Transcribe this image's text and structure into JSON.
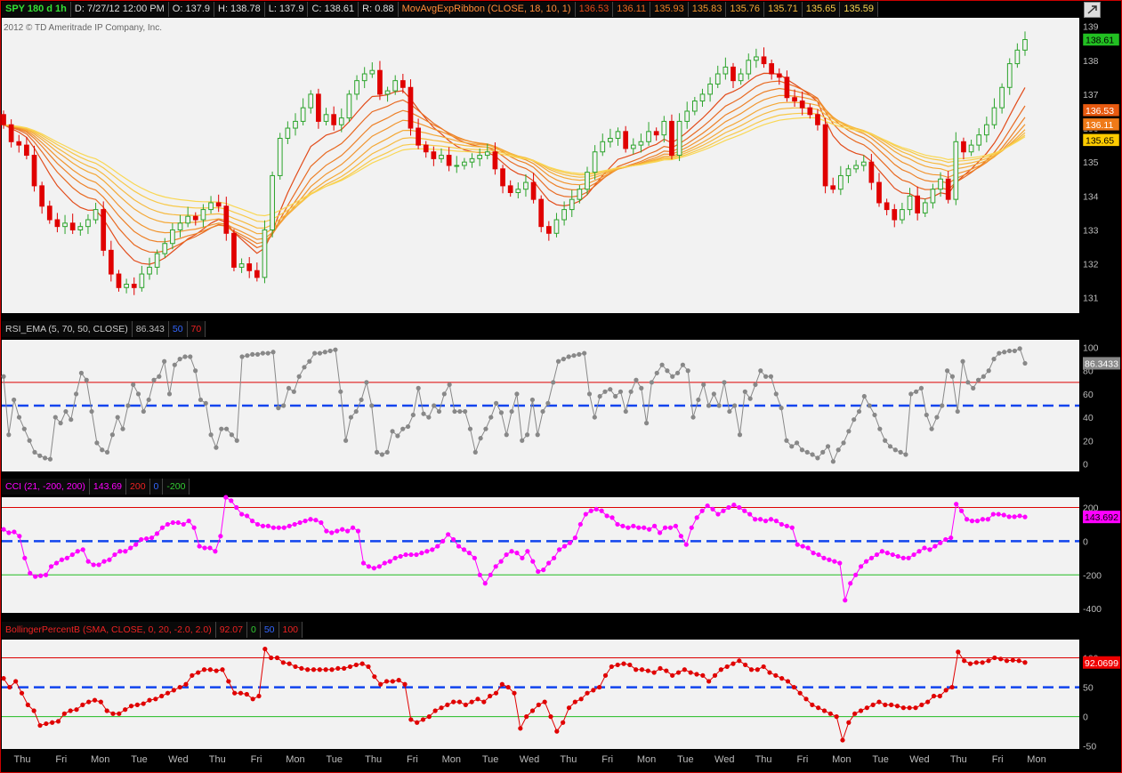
{
  "header": {
    "symbol": "SPY 180 d 1h",
    "date": "D: 7/27/12 12:00 PM",
    "open": "O: 137.9",
    "high": "H: 138.78",
    "low": "L: 137.9",
    "close": "C: 138.61",
    "range": "R: 0.88",
    "study": "MovAvgExpRibbon (CLOSE, 18, 10, 1)",
    "ribbon_values": [
      "136.53",
      "136.11",
      "135.93",
      "135.83",
      "135.76",
      "135.71",
      "135.65",
      "135.59"
    ],
    "copyright": "2012 © TD Ameritrade IP Company, Inc."
  },
  "colors": {
    "up": "#2ca42c",
    "down": "#e00000",
    "background": "#f2f2f2",
    "rsi_line": "#888888",
    "cci_line": "#ff00ff",
    "pctb_line": "#e00000",
    "ribbon": [
      "#e24b1a",
      "#e86a22",
      "#ed8128",
      "#f1952f",
      "#f4a836",
      "#f6b93e",
      "#f8c948",
      "#f9d754"
    ]
  },
  "price_tags": [
    {
      "value": 138.61,
      "text": "138.61",
      "bg": "#22c022",
      "fg": "#000"
    },
    {
      "value": 136.53,
      "text": "136.53",
      "bg": "#e85a10",
      "fg": "#fff"
    },
    {
      "value": 136.11,
      "text": "136.11",
      "bg": "#ef7a18",
      "fg": "#fff"
    },
    {
      "value": 135.65,
      "text": "135.65",
      "bg": "#ffcc00",
      "fg": "#000"
    }
  ],
  "rsi_panel": {
    "label": "RSI_EMA (5, 70, 50, CLOSE)",
    "value": "86.343",
    "mid": "50",
    "upper": "70",
    "tag": "86.3433",
    "ticks": [
      "100",
      "80",
      "60",
      "40",
      "20",
      "0"
    ]
  },
  "cci_panel": {
    "label": "CCI (21, -200, 200)",
    "value": "143.69",
    "upper": "200",
    "mid": "0",
    "lower": "-200",
    "tag": "143.692",
    "ticks": [
      "200",
      "0",
      "-200",
      "-400"
    ]
  },
  "pctb_panel": {
    "label": "BollingerPercentB (SMA, CLOSE, 0, 20, -2.0, 2.0)",
    "value": "92.07",
    "lower": "0",
    "mid": "50",
    "upper": "100",
    "tag": "92.0699",
    "ticks": [
      "100",
      "50",
      "0",
      "-50"
    ]
  },
  "x_axis": {
    "labels": [
      "Thu",
      "Fri",
      "Mon",
      "Tue",
      "Wed",
      "Thu",
      "Fri",
      "Mon",
      "Tue",
      "Thu",
      "Fri",
      "Mon",
      "Tue",
      "Wed",
      "Thu",
      "Fri",
      "Mon",
      "Tue",
      "Wed",
      "Thu",
      "Fri",
      "Mon",
      "Tue",
      "Wed",
      "Thu",
      "Fri",
      "Mon"
    ]
  },
  "chart_data": [
    {
      "type": "candlestick",
      "title": "SPY 180 d 1h",
      "ylim": [
        130.6,
        139.2
      ],
      "yticks": [
        131,
        132,
        133,
        134,
        135,
        136,
        137,
        138,
        139
      ],
      "close": [
        136.1,
        135.6,
        135.5,
        135.2,
        134.3,
        133.7,
        133.3,
        133.1,
        133.2,
        133.0,
        133.1,
        133.3,
        133.6,
        132.4,
        131.7,
        131.3,
        131.4,
        131.3,
        131.7,
        131.9,
        132.3,
        132.6,
        133.0,
        133.2,
        133.4,
        133.3,
        133.6,
        133.8,
        133.7,
        132.9,
        131.9,
        132.0,
        131.8,
        131.6,
        133.0,
        134.6,
        135.7,
        136.0,
        136.2,
        136.6,
        137.0,
        136.2,
        136.4,
        136.1,
        136.3,
        137.0,
        137.4,
        137.6,
        137.7,
        137.0,
        137.1,
        137.4,
        137.2,
        136.0,
        135.5,
        135.3,
        135.1,
        135.2,
        134.9,
        134.9,
        135.0,
        135.1,
        135.2,
        135.3,
        134.8,
        134.3,
        134.1,
        134.2,
        134.4,
        133.9,
        133.1,
        132.9,
        133.3,
        133.6,
        133.9,
        134.2,
        134.7,
        135.3,
        135.6,
        135.7,
        135.9,
        135.4,
        135.5,
        135.6,
        135.9,
        135.8,
        136.2,
        135.2,
        136.2,
        136.5,
        136.8,
        137.0,
        137.3,
        137.6,
        137.8,
        137.4,
        137.6,
        138.0,
        138.1,
        137.9,
        137.6,
        137.5,
        136.9,
        136.8,
        136.6,
        136.4,
        136.1,
        134.3,
        134.2,
        134.6,
        134.8,
        134.9,
        135.0,
        134.4,
        133.8,
        133.6,
        133.3,
        133.6,
        134.0,
        133.5,
        133.8,
        134.2,
        134.5,
        133.9,
        135.6,
        135.3,
        135.5,
        135.8,
        136.1,
        136.6,
        137.2,
        137.9,
        138.3,
        138.61
      ],
      "open": [
        136.4,
        136.1,
        135.6,
        135.5,
        135.2,
        134.3,
        133.7,
        133.3,
        133.1,
        133.2,
        133.0,
        133.1,
        133.3,
        133.6,
        132.4,
        131.7,
        131.3,
        131.4,
        131.3,
        131.7,
        131.9,
        132.3,
        132.6,
        133.0,
        133.2,
        133.4,
        133.3,
        133.6,
        133.8,
        133.7,
        132.9,
        131.9,
        132.0,
        131.8,
        131.6,
        133.0,
        134.6,
        135.7,
        136.0,
        136.2,
        136.6,
        137.0,
        136.2,
        136.4,
        136.1,
        136.3,
        137.0,
        137.4,
        137.6,
        137.7,
        137.0,
        137.1,
        137.4,
        137.2,
        136.0,
        135.5,
        135.3,
        135.1,
        135.2,
        134.9,
        134.9,
        135.0,
        135.1,
        135.2,
        135.3,
        134.8,
        134.3,
        134.1,
        134.2,
        134.4,
        133.9,
        133.1,
        132.9,
        133.3,
        133.6,
        133.9,
        134.2,
        134.7,
        135.3,
        135.6,
        135.7,
        135.9,
        135.4,
        135.5,
        135.6,
        135.9,
        135.8,
        136.2,
        135.2,
        136.2,
        136.5,
        136.8,
        137.0,
        137.3,
        137.6,
        137.8,
        137.4,
        137.6,
        138.0,
        138.1,
        137.9,
        137.6,
        137.5,
        136.9,
        136.8,
        136.6,
        136.4,
        136.1,
        134.3,
        134.2,
        134.6,
        134.8,
        134.9,
        135.0,
        134.4,
        133.8,
        133.6,
        133.3,
        133.6,
        134.0,
        133.5,
        133.8,
        134.2,
        134.5,
        133.9,
        135.6,
        135.3,
        135.5,
        135.8,
        136.1,
        136.6,
        137.2,
        137.9,
        138.3
      ]
    },
    {
      "type": "line",
      "title": "RSI_EMA (5, 70, 50, CLOSE)",
      "ylim": [
        -5,
        105
      ],
      "values": [
        75,
        25,
        55,
        40,
        30,
        20,
        10,
        7,
        5,
        4,
        40,
        35,
        45,
        38,
        60,
        78,
        72,
        45,
        18,
        12,
        10,
        25,
        40,
        30,
        50,
        68,
        60,
        45,
        55,
        72,
        75,
        88,
        60,
        85,
        90,
        92,
        92,
        80,
        55,
        52,
        25,
        14,
        30,
        30,
        25,
        20,
        92,
        93,
        94,
        94,
        95,
        95,
        96,
        48,
        50,
        65,
        62,
        75,
        83,
        88,
        95,
        95,
        96,
        97,
        98,
        62,
        20,
        40,
        45,
        55,
        70,
        50,
        10,
        8,
        10,
        28,
        24,
        30,
        32,
        42,
        65,
        43,
        40,
        50,
        45,
        60,
        68,
        45,
        45,
        45,
        30,
        10,
        22,
        30,
        40,
        52,
        44,
        25,
        45,
        60,
        20,
        25,
        55,
        25,
        45,
        52,
        70,
        88,
        90,
        92,
        93,
        94,
        95,
        60,
        40,
        58,
        62,
        64,
        58,
        62,
        45,
        62,
        72,
        65,
        35,
        70,
        78,
        85,
        80,
        75,
        78,
        85,
        80,
        40,
        55,
        68,
        50,
        60,
        50,
        70,
        45,
        50,
        25,
        62,
        56,
        68,
        80,
        75,
        75,
        60,
        48,
        20,
        15,
        18,
        12,
        10,
        8,
        5,
        10,
        15,
        2,
        12,
        18,
        28,
        38,
        45,
        58,
        50,
        42,
        30,
        20,
        15,
        12,
        10,
        8,
        60,
        62,
        65,
        42,
        30,
        40,
        50,
        80,
        75,
        45,
        88,
        70,
        65,
        72,
        75,
        80,
        90,
        95,
        96,
        97,
        97,
        99,
        86.34
      ]
    },
    {
      "type": "line",
      "title": "CCI (21, -200, 200)",
      "ylim": [
        -420,
        250
      ],
      "values": [
        70,
        50,
        55,
        30,
        -100,
        -190,
        -210,
        -205,
        -200,
        -150,
        -130,
        -110,
        -100,
        -80,
        -60,
        -50,
        -120,
        -140,
        -140,
        -120,
        -110,
        -80,
        -60,
        -60,
        -40,
        -20,
        10,
        15,
        20,
        45,
        80,
        100,
        110,
        110,
        100,
        120,
        80,
        -30,
        -40,
        -40,
        -60,
        30,
        260,
        240,
        200,
        160,
        150,
        120,
        100,
        90,
        90,
        80,
        80,
        80,
        90,
        100,
        110,
        120,
        130,
        125,
        110,
        60,
        50,
        60,
        70,
        60,
        80,
        60,
        -130,
        -150,
        -160,
        -150,
        -130,
        -120,
        -100,
        -90,
        -80,
        -80,
        -80,
        -70,
        -60,
        -50,
        -30,
        0,
        40,
        10,
        -30,
        -50,
        -70,
        -100,
        -200,
        -250,
        -200,
        -150,
        -120,
        -80,
        -60,
        -70,
        -100,
        -60,
        -120,
        -180,
        -170,
        -130,
        -100,
        -50,
        -30,
        -10,
        20,
        100,
        160,
        180,
        190,
        180,
        150,
        140,
        100,
        90,
        80,
        90,
        80,
        80,
        70,
        90,
        50,
        80,
        80,
        90,
        30,
        -20,
        80,
        140,
        180,
        210,
        190,
        160,
        180,
        200,
        215,
        200,
        180,
        160,
        130,
        130,
        120,
        130,
        120,
        100,
        90,
        80,
        -20,
        -30,
        -40,
        -70,
        -80,
        -100,
        -110,
        -120,
        -130,
        -350,
        -250,
        -200,
        -150,
        -120,
        -100,
        -80,
        -60,
        -70,
        -80,
        -90,
        -100,
        -100,
        -80,
        -60,
        -40,
        -50,
        -30,
        -10,
        10,
        20,
        220,
        180,
        130,
        120,
        120,
        130,
        130,
        160,
        160,
        155,
        145,
        145,
        150,
        143.69
      ]
    },
    {
      "type": "line",
      "title": "BollingerPercentB (SMA, CLOSE, 0, 20, -2.0, 2.0)",
      "ylim": [
        -52,
        128
      ],
      "values": [
        65,
        50,
        60,
        40,
        20,
        10,
        -15,
        -12,
        -10,
        -8,
        5,
        10,
        12,
        20,
        25,
        28,
        25,
        10,
        5,
        5,
        12,
        18,
        20,
        22,
        28,
        30,
        35,
        40,
        45,
        50,
        55,
        70,
        75,
        80,
        80,
        78,
        80,
        60,
        40,
        40,
        38,
        30,
        35,
        115,
        100,
        100,
        92,
        90,
        85,
        82,
        80,
        80,
        80,
        80,
        80,
        82,
        82,
        85,
        88,
        90,
        85,
        68,
        55,
        60,
        60,
        62,
        55,
        -5,
        -10,
        -5,
        0,
        10,
        15,
        20,
        25,
        25,
        20,
        25,
        30,
        25,
        35,
        40,
        55,
        50,
        40,
        -20,
        0,
        10,
        20,
        25,
        0,
        -25,
        -10,
        15,
        25,
        30,
        40,
        45,
        50,
        70,
        85,
        88,
        90,
        88,
        80,
        80,
        78,
        75,
        82,
        78,
        70,
        75,
        80,
        75,
        72,
        70,
        60,
        70,
        80,
        85,
        90,
        95,
        88,
        80,
        80,
        85,
        75,
        70,
        65,
        60,
        50,
        40,
        30,
        20,
        15,
        10,
        5,
        0,
        -40,
        -10,
        5,
        10,
        15,
        20,
        25,
        20,
        20,
        18,
        15,
        15,
        15,
        20,
        25,
        35,
        35,
        45,
        50,
        110,
        95,
        90,
        92,
        92,
        95,
        100,
        98,
        95,
        96,
        95,
        92.07
      ]
    }
  ]
}
